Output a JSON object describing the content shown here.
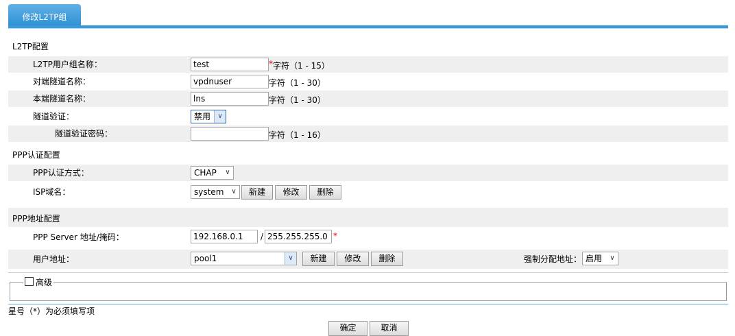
{
  "tab": {
    "label": "修改L2TP组"
  },
  "l2tp": {
    "section": "L2TP配置",
    "group_name_label": "L2TP用户组名称：",
    "group_name_value": "test",
    "group_name_hint": "字符（1 - 15）",
    "peer_tunnel_label": "对端隧道名称：",
    "peer_tunnel_value": "vpdnuser",
    "peer_tunnel_hint": "字符（1 - 30）",
    "local_tunnel_label": "本端隧道名称：",
    "local_tunnel_value": "lns",
    "local_tunnel_hint": "字符（1 - 30）",
    "tunnel_auth_label": "隧道验证：",
    "tunnel_auth_value": "禁用",
    "tunnel_pwd_label": "隧道验证密码：",
    "tunnel_pwd_value": "",
    "tunnel_pwd_hint": "字符（1 - 16）"
  },
  "ppp_auth": {
    "section": "PPP认证配置",
    "method_label": "PPP认证方式：",
    "method_value": "CHAP",
    "isp_label": "ISP域名：",
    "isp_value": "system",
    "new": "新建",
    "edit": "修改",
    "delete": "删除"
  },
  "ppp_addr": {
    "section": "PPP地址配置",
    "server_label": "PPP Server 地址/掩码：",
    "server_ip": "192.168.0.1",
    "slash": "/",
    "server_mask": "255.255.255.0",
    "user_addr_label": "用户地址：",
    "user_addr_value": "pool1",
    "new": "新建",
    "edit": "修改",
    "delete": "删除",
    "force_label": "强制分配地址：",
    "force_value": "启用"
  },
  "advanced": {
    "label": "高级"
  },
  "footer": {
    "note": "星号（*）为必须填写项",
    "ok": "确定",
    "cancel": "取消"
  },
  "required_mark": "*",
  "colors": {
    "tab": "#3a9ad8",
    "required": "#dd0000",
    "row_gray": "#efefef"
  }
}
